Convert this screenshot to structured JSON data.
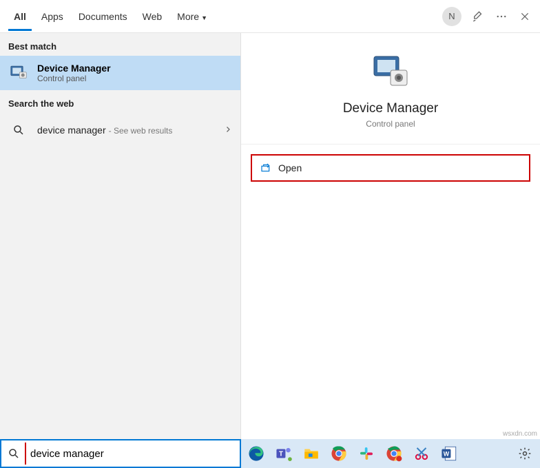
{
  "header": {
    "tabs": {
      "all": "All",
      "apps": "Apps",
      "documents": "Documents",
      "web": "Web",
      "more": "More"
    },
    "avatar_initial": "N"
  },
  "left": {
    "best_match_label": "Best match",
    "best_match": {
      "title": "Device Manager",
      "subtitle": "Control panel"
    },
    "search_web_label": "Search the web",
    "web_result": {
      "query": "device manager",
      "suffix": " - See web results"
    }
  },
  "preview": {
    "title": "Device Manager",
    "subtitle": "Control panel",
    "open_label": "Open"
  },
  "search": {
    "value": "device manager"
  },
  "watermark": "wsxdn.com"
}
